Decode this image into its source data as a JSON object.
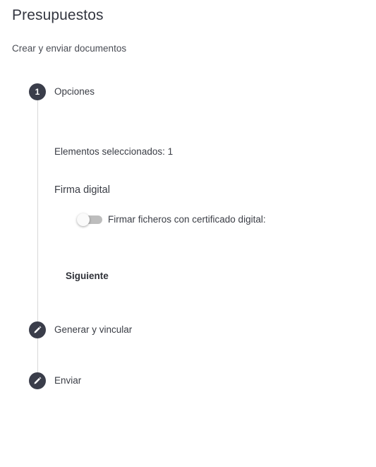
{
  "header": {
    "title": "Presupuestos",
    "subtitle": "Crear y enviar documentos"
  },
  "steps": [
    {
      "number": "1",
      "label": "Opciones",
      "icon": "number",
      "state": "active"
    },
    {
      "label": "Generar y vincular",
      "icon": "pencil-icon",
      "state": "editable"
    },
    {
      "label": "Enviar",
      "icon": "pencil-icon",
      "state": "editable"
    }
  ],
  "options": {
    "selected_text": "Elementos seleccionados: 1",
    "signature_title": "Firma digital",
    "toggle_label": "Firmar ficheros con certificado digital:",
    "toggle_on": false,
    "next_label": "Siguiente"
  },
  "colors": {
    "step_circle": "#3a3d4a",
    "connector": "#d8d8d8",
    "toggle_track_off": "#bdbdbd"
  }
}
